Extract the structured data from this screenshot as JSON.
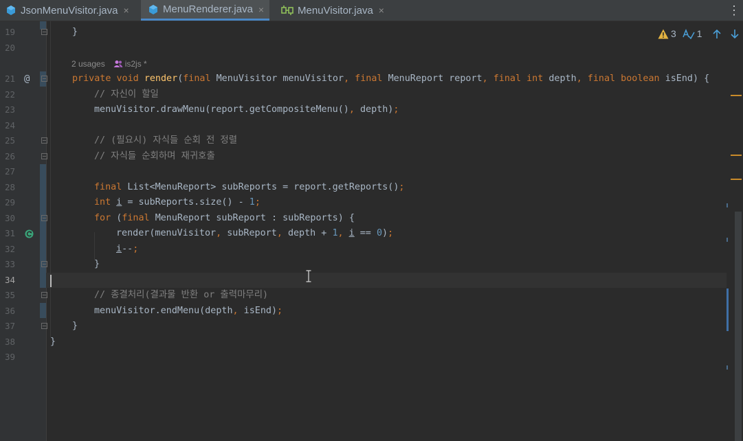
{
  "tabs": [
    {
      "label": "JsonMenuVisitor.java",
      "close": "×"
    },
    {
      "label": "MenuRenderer.java",
      "close": "×"
    },
    {
      "label": "MenuVisitor.java",
      "close": "×"
    }
  ],
  "menu": "⋮",
  "inspection": {
    "warnings": "3",
    "typos": "1"
  },
  "inlay": {
    "usages": "2 usages",
    "author": "is2js *"
  },
  "gutter": {
    "at_marker": "@"
  },
  "lines": [
    {
      "n": "19",
      "t": "}"
    },
    {
      "n": "20",
      "t": ""
    },
    {
      "n": "21",
      "t": "private void render(final MenuVisitor menuVisitor, final MenuReport report, final int depth, final boolean isEnd) {"
    },
    {
      "n": "22",
      "t": "// 자신이 할일"
    },
    {
      "n": "23",
      "t": "menuVisitor.drawMenu(report.getCompositeMenu(), depth);"
    },
    {
      "n": "24",
      "t": ""
    },
    {
      "n": "25",
      "t": "// (필요시) 자식들 순회 전 정렬"
    },
    {
      "n": "26",
      "t": "// 자식들 순회하며 재귀호출"
    },
    {
      "n": "27",
      "t": ""
    },
    {
      "n": "28",
      "t": "final List<MenuReport> subReports = report.getReports();"
    },
    {
      "n": "29",
      "t": "int i = subReports.size() - 1;"
    },
    {
      "n": "30",
      "t": "for (final MenuReport subReport : subReports) {"
    },
    {
      "n": "31",
      "t": "render(menuVisitor, subReport, depth + 1, i == 0);"
    },
    {
      "n": "32",
      "t": "i--;"
    },
    {
      "n": "33",
      "t": "}"
    },
    {
      "n": "34",
      "t": ""
    },
    {
      "n": "35",
      "t": "// 종결처리(결과물 반환 or 출력마무리)"
    },
    {
      "n": "36",
      "t": "menuVisitor.endMenu(depth, isEnd);"
    },
    {
      "n": "37",
      "t": "}"
    },
    {
      "n": "38",
      "t": "}"
    },
    {
      "n": "39",
      "t": ""
    }
  ],
  "colors": {
    "keyword": "#cc7832",
    "method": "#ffc66d",
    "comment": "#808080",
    "number": "#6897bb",
    "text": "#a9b7c6",
    "accent": "#4a88c7",
    "warning": "#e3b341"
  },
  "icons": [
    "java-class-icon",
    "java-interface-icon",
    "warning-icon",
    "typo-icon",
    "arrow-up-icon",
    "arrow-down-icon",
    "users-icon",
    "recursion-icon",
    "fold-icon"
  ]
}
